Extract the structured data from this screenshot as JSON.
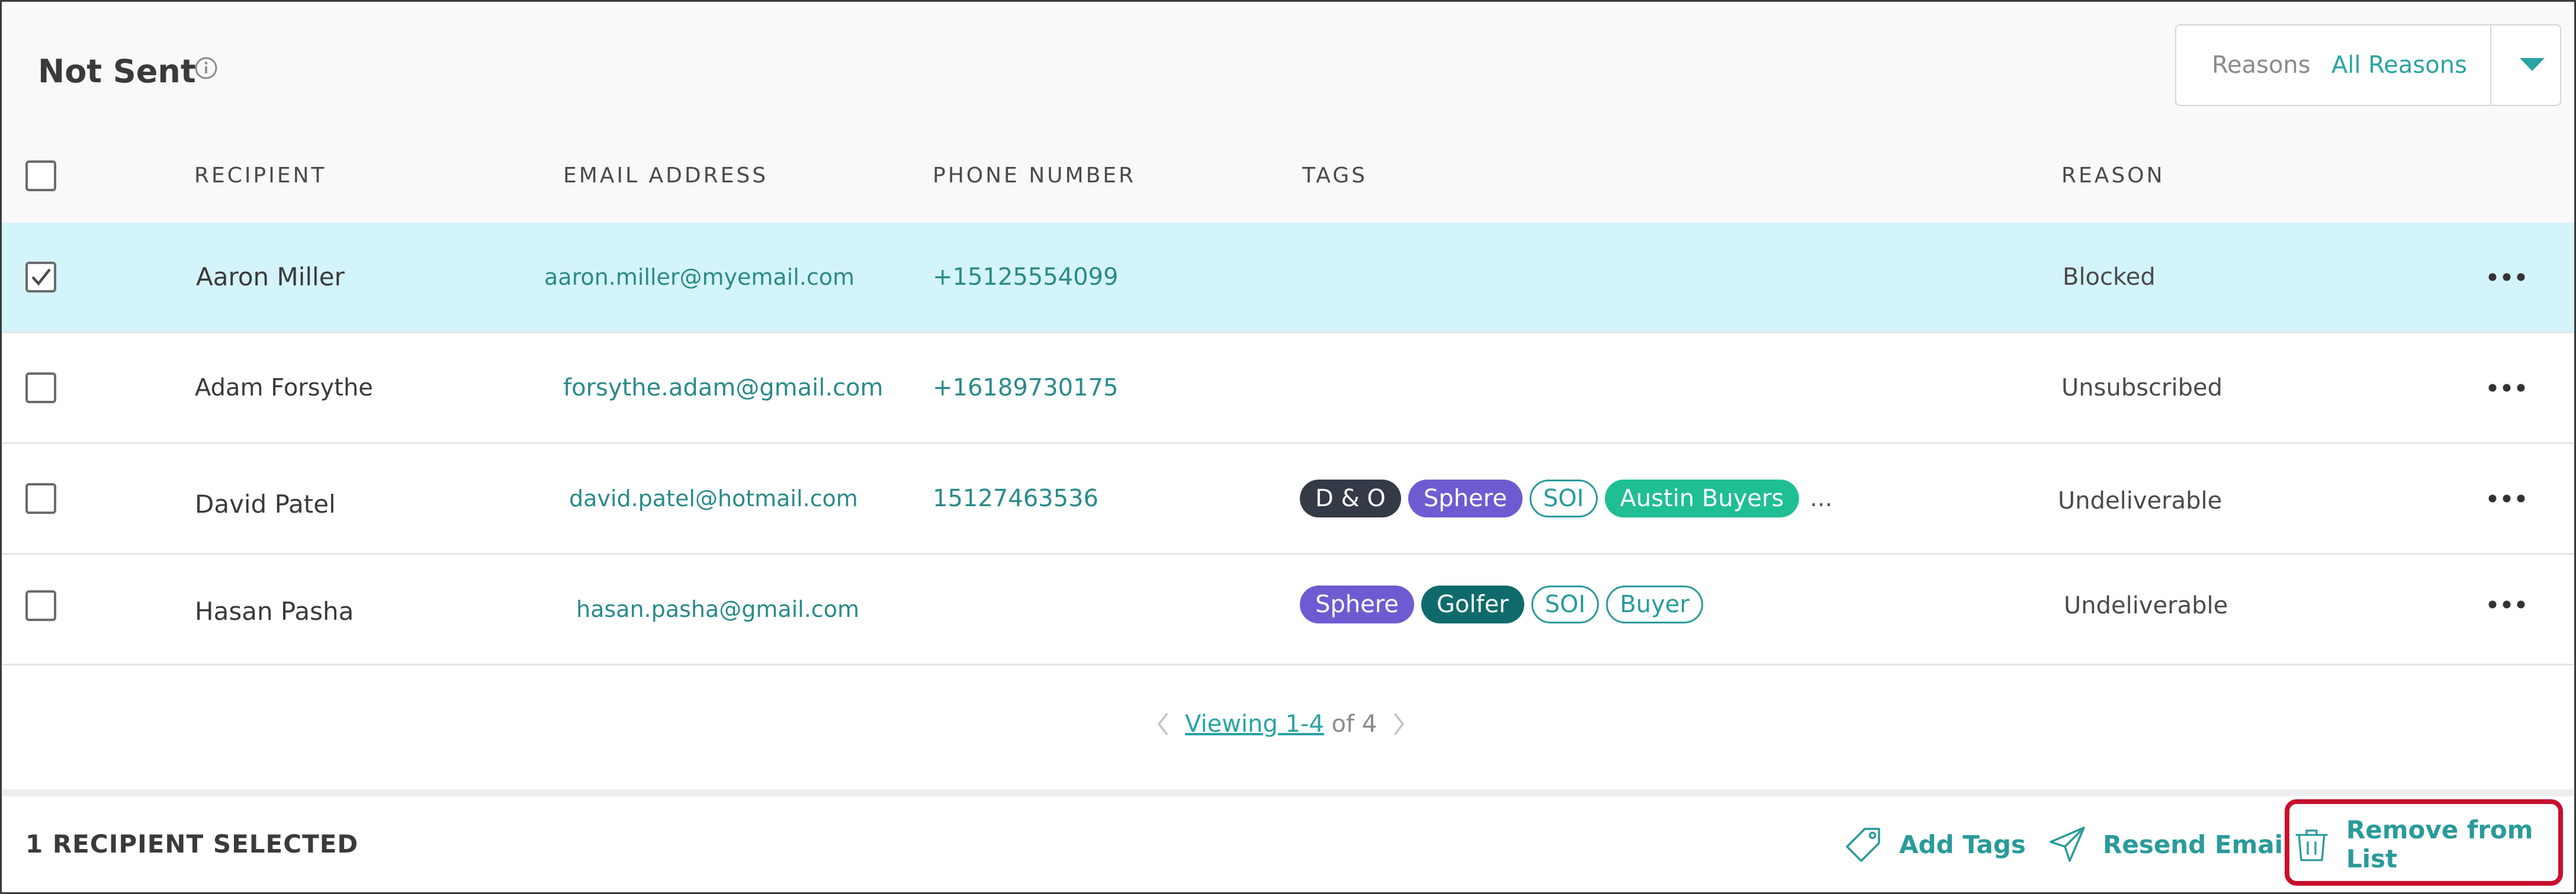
{
  "header": {
    "title": "Not Sent",
    "info_icon": "info-icon",
    "reasons_filter": {
      "label": "Reasons",
      "value": "All Reasons",
      "caret_icon": "caret-down-icon"
    }
  },
  "columns": {
    "recipient": "RECIPIENT",
    "email": "EMAIL ADDRESS",
    "phone": "PHONE NUMBER",
    "tags": "TAGS",
    "reason": "REASON"
  },
  "rows": [
    {
      "name": "Aaron Miller",
      "email": "aaron.miller@myemail.com",
      "phone": "+15125554099",
      "tags": [],
      "reason": "Blocked",
      "checked": true
    },
    {
      "name": "Adam Forsythe",
      "email": "forsythe.adam@gmail.com",
      "phone": "+16189730175",
      "tags": [],
      "reason": "Unsubscribed",
      "checked": false
    },
    {
      "name": "David Patel",
      "email": "david.patel@hotmail.com",
      "phone": "15127463536",
      "tags": [
        {
          "label": "D & O",
          "color": "#343a46",
          "style": "filled"
        },
        {
          "label": "Sphere",
          "color": "#6f5bd1",
          "style": "filled"
        },
        {
          "label": "SOI",
          "color": "#2a9a9a",
          "style": "outline"
        },
        {
          "label": "Austin Buyers",
          "color": "#1fbf93",
          "style": "filled"
        }
      ],
      "tags_more": "...",
      "reason": "Undeliverable",
      "checked": false
    },
    {
      "name": "Hasan Pasha",
      "email": "hasan.pasha@gmail.com",
      "phone": "",
      "tags": [
        {
          "label": "Sphere",
          "color": "#6f5bd1",
          "style": "filled"
        },
        {
          "label": "Golfer",
          "color": "#0f6b6b",
          "style": "filled"
        },
        {
          "label": "SOI",
          "color": "#2a9a9a",
          "style": "outline"
        },
        {
          "label": "Buyer",
          "color": "#2a9a9a",
          "style": "outline"
        }
      ],
      "reason": "Undeliverable",
      "checked": false
    }
  ],
  "pagination": {
    "link_text": "Viewing 1-4",
    "of_text": "of 4"
  },
  "footer": {
    "selected_text": "1 RECIPIENT SELECTED",
    "actions": {
      "add_tags": "Add Tags",
      "resend_email": "Resend Email",
      "remove_from_list": "Remove from List"
    },
    "highlight_color": "#c8102e"
  },
  "colors": {
    "accent": "#2aa3a3",
    "selected_row": "#d4f4fb",
    "header_bg": "#f9f9f9"
  }
}
